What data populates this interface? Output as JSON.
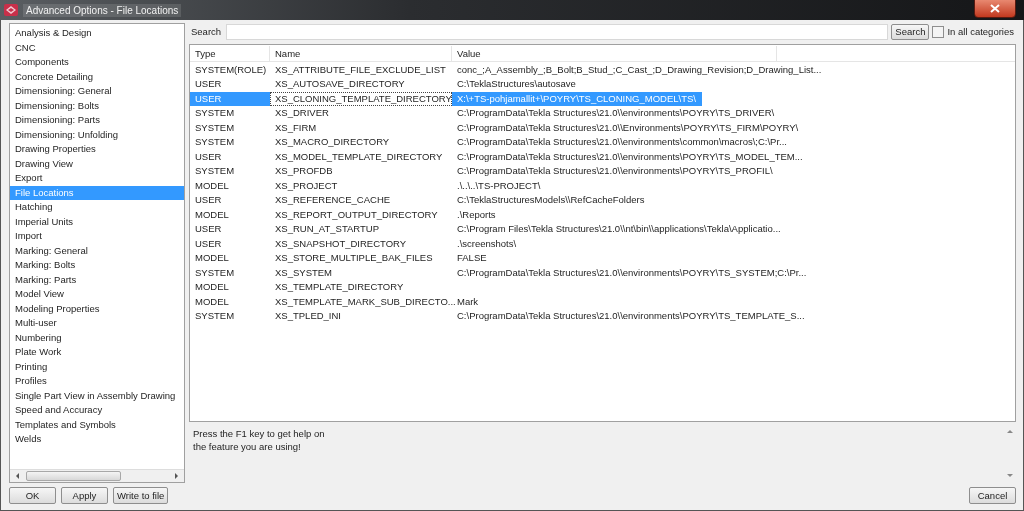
{
  "window": {
    "title": "Advanced Options - File Locations"
  },
  "sidebar": {
    "items": [
      {
        "label": "Analysis & Design",
        "selected": false
      },
      {
        "label": "CNC",
        "selected": false
      },
      {
        "label": "Components",
        "selected": false
      },
      {
        "label": "Concrete Detailing",
        "selected": false
      },
      {
        "label": "Dimensioning: General",
        "selected": false
      },
      {
        "label": "Dimensioning: Bolts",
        "selected": false
      },
      {
        "label": "Dimensioning: Parts",
        "selected": false
      },
      {
        "label": "Dimensioning: Unfolding",
        "selected": false
      },
      {
        "label": "Drawing Properties",
        "selected": false
      },
      {
        "label": "Drawing View",
        "selected": false
      },
      {
        "label": "Export",
        "selected": false
      },
      {
        "label": "File Locations",
        "selected": true
      },
      {
        "label": "Hatching",
        "selected": false
      },
      {
        "label": "Imperial Units",
        "selected": false
      },
      {
        "label": "Import",
        "selected": false
      },
      {
        "label": "Marking: General",
        "selected": false
      },
      {
        "label": "Marking: Bolts",
        "selected": false
      },
      {
        "label": "Marking: Parts",
        "selected": false
      },
      {
        "label": "Model View",
        "selected": false
      },
      {
        "label": "Modeling Properties",
        "selected": false
      },
      {
        "label": "Multi-user",
        "selected": false
      },
      {
        "label": "Numbering",
        "selected": false
      },
      {
        "label": "Plate Work",
        "selected": false
      },
      {
        "label": "Printing",
        "selected": false
      },
      {
        "label": "Profiles",
        "selected": false
      },
      {
        "label": "Single Part View in Assembly Drawing",
        "selected": false
      },
      {
        "label": "Speed and Accuracy",
        "selected": false
      },
      {
        "label": "Templates and Symbols",
        "selected": false
      },
      {
        "label": "Welds",
        "selected": false
      }
    ]
  },
  "search": {
    "label": "Search",
    "button": "Search",
    "all_categories": {
      "label": "In all categories",
      "checked": false
    }
  },
  "table": {
    "columns": [
      "Type",
      "Name",
      "Value"
    ],
    "rows": [
      {
        "type": "SYSTEM(ROLE)",
        "name": "XS_ATTRIBUTE_FILE_EXCLUDE_LIST",
        "value": "conc_;A_Assembly_;B_Bolt;B_Stud_;C_Cast_;D_Drawing_Revision;D_Drawing_List...",
        "selected": false
      },
      {
        "type": "USER",
        "name": "XS_AUTOSAVE_DIRECTORY",
        "value": "C:\\TeklaStructures\\autosave",
        "selected": false
      },
      {
        "type": "USER",
        "name": "XS_CLONING_TEMPLATE_DIRECTORY",
        "value": "X:\\+TS-pohjamallit+\\POYRY\\TS_CLONING_MODEL\\TS\\",
        "selected": true
      },
      {
        "type": "SYSTEM",
        "name": "XS_DRIVER",
        "value": "C:\\ProgramData\\Tekla Structures\\21.0\\\\environments\\POYRY\\TS_DRIVER\\",
        "selected": false
      },
      {
        "type": "SYSTEM",
        "name": "XS_FIRM",
        "value": "C:\\ProgramData\\Tekla Structures\\21.0\\\\Environments\\POYRY\\TS_FIRM\\POYRY\\",
        "selected": false
      },
      {
        "type": "SYSTEM",
        "name": "XS_MACRO_DIRECTORY",
        "value": "C:\\ProgramData\\Tekla Structures\\21.0\\\\environments\\common\\macros\\;C:\\Pr...",
        "selected": false
      },
      {
        "type": "USER",
        "name": "XS_MODEL_TEMPLATE_DIRECTORY",
        "value": "C:\\ProgramData\\Tekla Structures\\21.0\\\\environments\\POYRY\\TS_MODEL_TEM...",
        "selected": false
      },
      {
        "type": "SYSTEM",
        "name": "XS_PROFDB",
        "value": "C:\\ProgramData\\Tekla Structures\\21.0\\\\environments\\POYRY\\TS_PROFIL\\",
        "selected": false
      },
      {
        "type": "MODEL",
        "name": "XS_PROJECT",
        "value": ".\\..\\..\\TS-PROJECT\\",
        "selected": false
      },
      {
        "type": "USER",
        "name": "XS_REFERENCE_CACHE",
        "value": "C:\\TeklaStructuresModels\\\\RefCacheFolders",
        "selected": false
      },
      {
        "type": "MODEL",
        "name": "XS_REPORT_OUTPUT_DIRECTORY",
        "value": ".\\Reports",
        "selected": false
      },
      {
        "type": "USER",
        "name": "XS_RUN_AT_STARTUP",
        "value": "C:\\Program Files\\Tekla Structures\\21.0\\\\nt\\bin\\\\applications\\Tekla\\Applicatio...",
        "selected": false
      },
      {
        "type": "USER",
        "name": "XS_SNAPSHOT_DIRECTORY",
        "value": ".\\screenshots\\",
        "selected": false
      },
      {
        "type": "MODEL",
        "name": "XS_STORE_MULTIPLE_BAK_FILES",
        "value": "FALSE",
        "selected": false
      },
      {
        "type": "SYSTEM",
        "name": "XS_SYSTEM",
        "value": "C:\\ProgramData\\Tekla Structures\\21.0\\\\environments\\POYRY\\TS_SYSTEM;C:\\Pr...",
        "selected": false
      },
      {
        "type": "MODEL",
        "name": "XS_TEMPLATE_DIRECTORY",
        "selected": false
      },
      {
        "type": "MODEL",
        "name": "XS_TEMPLATE_MARK_SUB_DIRECTO...",
        "value": "Mark",
        "selected": false
      },
      {
        "type": "SYSTEM",
        "name": "XS_TPLED_INI",
        "value": "C:\\ProgramData\\Tekla Structures\\21.0\\\\environments\\POYRY\\TS_TEMPLATE_S...",
        "selected": false
      }
    ]
  },
  "help": {
    "lines": [
      "Press the F1 key to get help on",
      "the feature you are using!"
    ]
  },
  "buttons": {
    "left": [
      "OK",
      "Apply",
      "Write to file"
    ],
    "right": [
      "Cancel"
    ]
  }
}
